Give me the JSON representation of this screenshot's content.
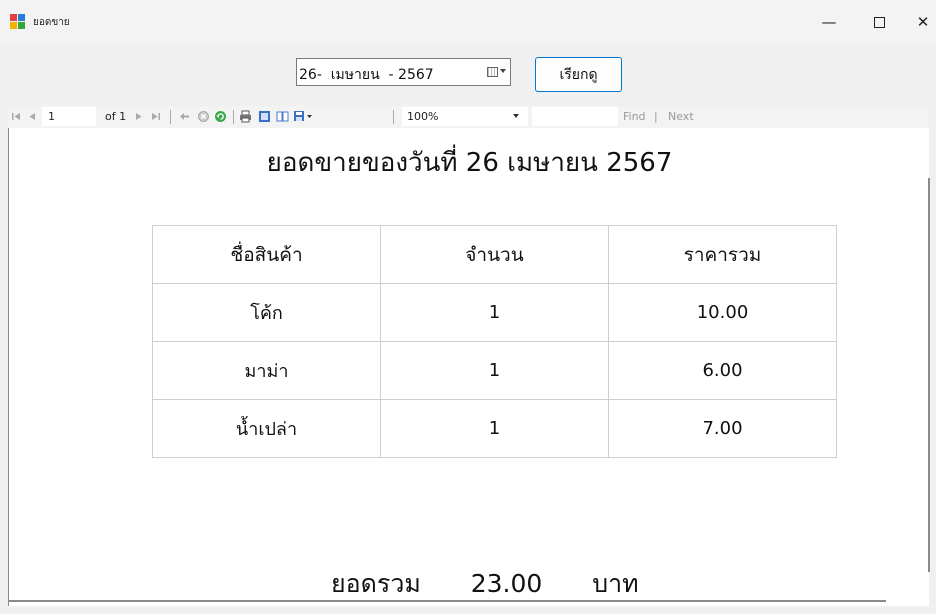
{
  "window": {
    "title": "ยอดขาย",
    "controls": {
      "minimize": "—",
      "close": "✕"
    }
  },
  "date_picker": {
    "value": "26-  เมษายน  - 2567"
  },
  "fetch_button": {
    "label": "เรียกดู"
  },
  "toolbar": {
    "page_current": "1",
    "page_of": "of 1",
    "zoom": "100%",
    "find_label": "Find",
    "separator": "|",
    "next_label": "Next"
  },
  "report": {
    "title": "ยอดขายของวันที่ 26 เมษายน 2567",
    "table": {
      "headers": [
        "ชื่อสินค้า",
        "จำนวน",
        "ราคารวม"
      ],
      "rows": [
        [
          "โค้ก",
          "1",
          "10.00"
        ],
        [
          "มาม่า",
          "1",
          "6.00"
        ],
        [
          "น้ำเปล่า",
          "1",
          "7.00"
        ]
      ]
    },
    "total": {
      "label": "ยอดรวม",
      "value": "23.00",
      "unit": "บาท"
    }
  },
  "colors": {
    "accent": "#0078d4",
    "background": "#f0f0f0",
    "report_bg": "#ffffff",
    "grid": "#cfcfcf"
  },
  "icons": [
    "app-icon",
    "first-page-icon",
    "previous-page-icon",
    "next-page-icon",
    "last-page-icon",
    "back-icon",
    "stop-icon",
    "refresh-icon",
    "print-icon",
    "print-layout-icon",
    "page-setup-icon",
    "export-icon",
    "calendar-icon"
  ]
}
